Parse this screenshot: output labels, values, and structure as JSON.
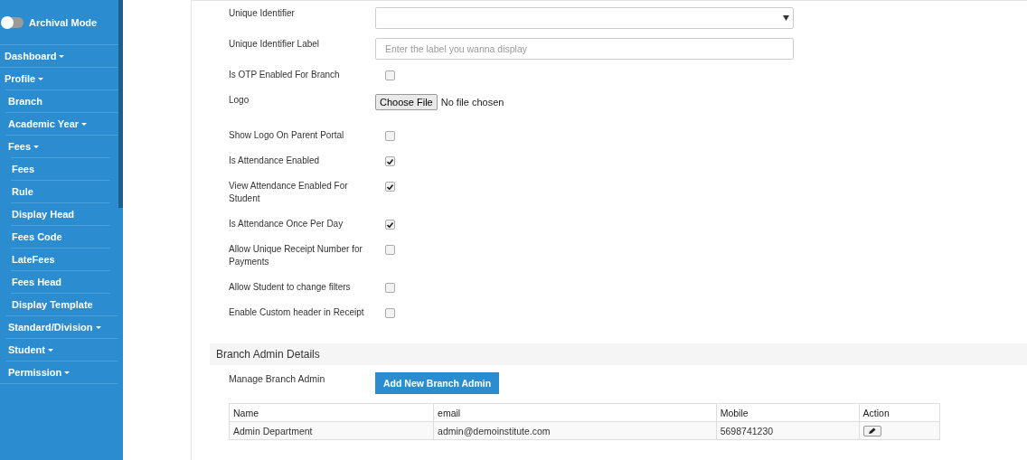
{
  "sidebar": {
    "archival_toggle": {
      "label": "Archival Mode",
      "on": false
    },
    "items": [
      {
        "label": "Dashboard",
        "caret": true
      },
      {
        "label": "Profile",
        "caret": true,
        "children": [
          {
            "label": "Branch",
            "caret": false
          },
          {
            "label": "Academic Year",
            "caret": true
          },
          {
            "label": "Fees",
            "caret": true,
            "children": [
              {
                "label": "Fees",
                "caret": false
              },
              {
                "label": "Rule",
                "caret": false
              },
              {
                "label": "Display Head",
                "caret": false
              },
              {
                "label": "Fees Code",
                "caret": false
              },
              {
                "label": "LateFees",
                "caret": false
              },
              {
                "label": "Fees Head",
                "caret": false
              },
              {
                "label": "Display Template",
                "caret": false
              }
            ]
          },
          {
            "label": "Standard/Division",
            "caret": true
          },
          {
            "label": "Student",
            "caret": true
          },
          {
            "label": "Permission",
            "caret": true
          }
        ]
      }
    ]
  },
  "form": {
    "fields": [
      {
        "label": "Unique Identifier",
        "kind": "select"
      },
      {
        "label": "Unique Identifier Label",
        "kind": "text",
        "placeholder": "Enter the label you wanna display"
      },
      {
        "label": "Is OTP Enabled For Branch",
        "kind": "checkbox",
        "checked": false
      },
      {
        "label": "Logo",
        "kind": "file",
        "button": "Choose File",
        "status": "No file chosen"
      },
      {
        "label": "Show Logo On Parent Portal",
        "kind": "checkbox",
        "checked": false
      },
      {
        "label": "Is Attendance Enabled",
        "kind": "checkbox",
        "checked": true
      },
      {
        "label": "View Attendance Enabled For Student",
        "kind": "checkbox",
        "checked": true
      },
      {
        "label": "Is Attendance Once Per Day",
        "kind": "checkbox",
        "checked": true
      },
      {
        "label": "Allow Unique Receipt Number for Payments",
        "kind": "checkbox",
        "checked": false
      },
      {
        "label": "Allow Student to change filters",
        "kind": "checkbox",
        "checked": false
      },
      {
        "label": "Enable Custom header in Receipt",
        "kind": "checkbox",
        "checked": false
      }
    ]
  },
  "branch_admin": {
    "title": "Branch Admin Details",
    "manage_label": "Manage Branch Admin",
    "add_button": "Add New Branch Admin",
    "table": {
      "columns": [
        "Name",
        "email",
        "Mobile",
        "Action"
      ],
      "rows": [
        {
          "name": "Admin Department",
          "email": "admin@demoinstitute.com",
          "mobile": "5698741230"
        }
      ]
    }
  }
}
